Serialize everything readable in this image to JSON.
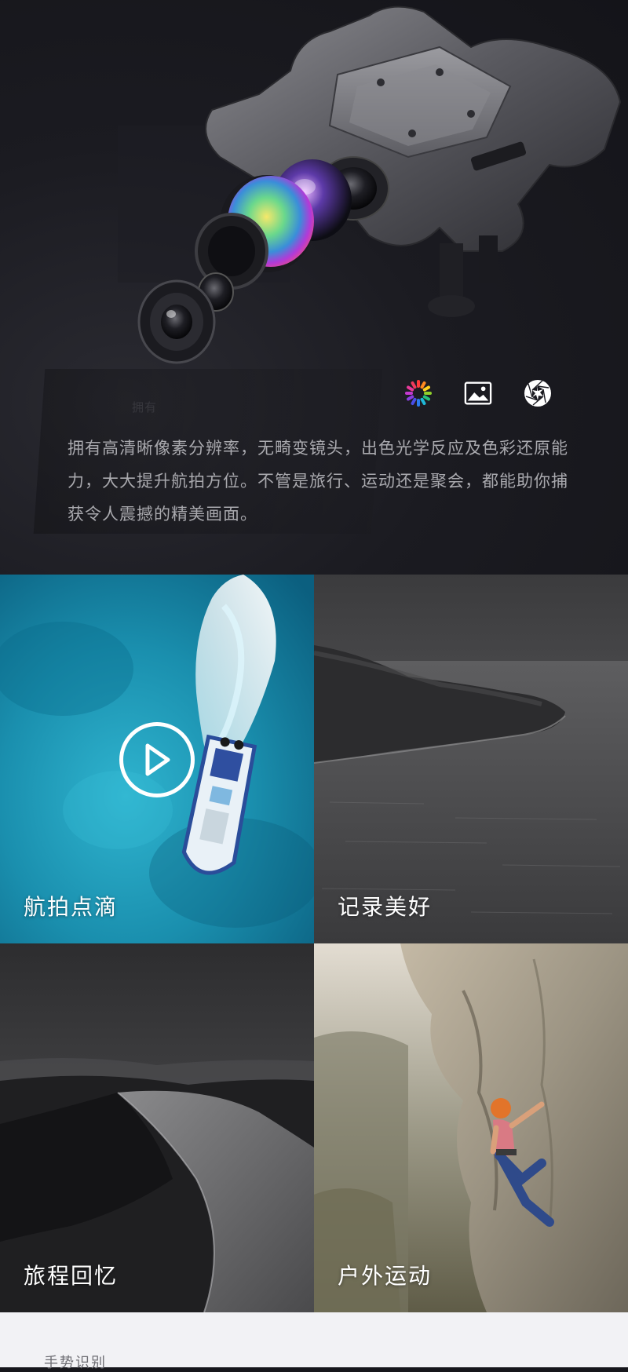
{
  "hero": {
    "description": "拥有高清晰像素分辨率，无畸变镜头，出色光学反应及色彩还原能力，大大提升航拍方位。不管是旅行、运动还是聚会，都能助你捕获令人震撼的精美画面。",
    "ghost_text": "拥有",
    "icons": [
      "color-wheel-icon",
      "image-icon",
      "aperture-icon"
    ]
  },
  "tiles": [
    {
      "label": "航拍点滴",
      "has_play": true
    },
    {
      "label": "记录美好"
    },
    {
      "label": "旅程回忆"
    },
    {
      "label": "户外运动"
    }
  ],
  "footer": {
    "heading": "手势识别"
  },
  "colors": {
    "hero_background": "#16161b",
    "description_text": "#a9a9ae",
    "tile_label": "#ffffff",
    "footer_background": "#f2f2f5"
  }
}
